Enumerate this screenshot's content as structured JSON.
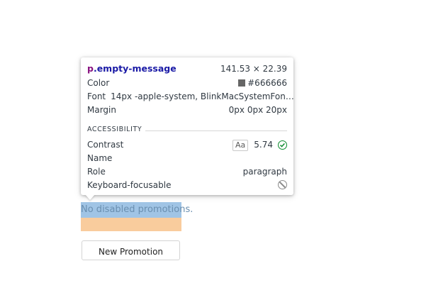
{
  "inspector": {
    "tag": "p",
    "class_name": ".empty-message",
    "size": "141.53 × 22.39",
    "rows": {
      "color_label": "Color",
      "color_value": "#666666",
      "font_label": "Font",
      "font_value": "14px -apple-system, BlinkMacSystemFon…",
      "margin_label": "Margin",
      "margin_value": "0px 0px 20px"
    },
    "accessibility": {
      "heading": "ACCESSIBILITY",
      "contrast_label": "Contrast",
      "contrast_badge": "Aa",
      "contrast_value": "5.74",
      "name_label": "Name",
      "role_label": "Role",
      "role_value": "paragraph",
      "keyboard_label": "Keyboard-focusable"
    },
    "colors": {
      "swatch": "#666666",
      "pass": "#0a8a2c",
      "tag": "#881280",
      "class": "#1a1aa6"
    }
  },
  "page": {
    "empty_message": "No disabled promotions.",
    "new_promotion_button": "New Promotion"
  }
}
